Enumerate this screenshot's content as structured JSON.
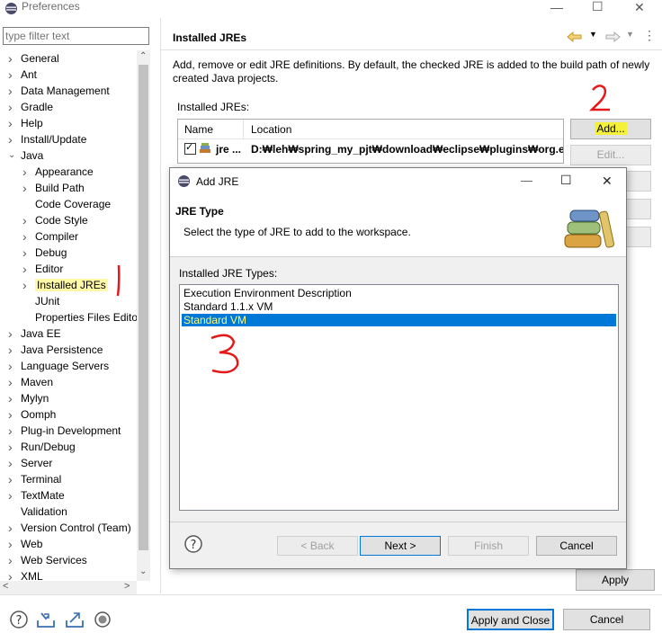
{
  "window": {
    "title": "Preferences"
  },
  "filter": {
    "placeholder": "type filter text"
  },
  "tree": [
    {
      "label": "General",
      "level": 0,
      "expandable": true
    },
    {
      "label": "Ant",
      "level": 0,
      "expandable": true
    },
    {
      "label": "Data Management",
      "level": 0,
      "expandable": true
    },
    {
      "label": "Gradle",
      "level": 0,
      "expandable": true
    },
    {
      "label": "Help",
      "level": 0,
      "expandable": true
    },
    {
      "label": "Install/Update",
      "level": 0,
      "expandable": true
    },
    {
      "label": "Java",
      "level": 0,
      "expandable": true,
      "expanded": true
    },
    {
      "label": "Appearance",
      "level": 1,
      "expandable": true
    },
    {
      "label": "Build Path",
      "level": 1,
      "expandable": true
    },
    {
      "label": "Code Coverage",
      "level": 1,
      "expandable": false
    },
    {
      "label": "Code Style",
      "level": 1,
      "expandable": true
    },
    {
      "label": "Compiler",
      "level": 1,
      "expandable": true
    },
    {
      "label": "Debug",
      "level": 1,
      "expandable": true
    },
    {
      "label": "Editor",
      "level": 1,
      "expandable": true
    },
    {
      "label": "Installed JREs",
      "level": 1,
      "expandable": true,
      "selected": true
    },
    {
      "label": "JUnit",
      "level": 1,
      "expandable": false
    },
    {
      "label": "Properties Files Edito",
      "level": 1,
      "expandable": false
    },
    {
      "label": "Java EE",
      "level": 0,
      "expandable": true
    },
    {
      "label": "Java Persistence",
      "level": 0,
      "expandable": true
    },
    {
      "label": "Language Servers",
      "level": 0,
      "expandable": true
    },
    {
      "label": "Maven",
      "level": 0,
      "expandable": true
    },
    {
      "label": "Mylyn",
      "level": 0,
      "expandable": true
    },
    {
      "label": "Oomph",
      "level": 0,
      "expandable": true
    },
    {
      "label": "Plug-in Development",
      "level": 0,
      "expandable": true
    },
    {
      "label": "Run/Debug",
      "level": 0,
      "expandable": true
    },
    {
      "label": "Server",
      "level": 0,
      "expandable": true
    },
    {
      "label": "Terminal",
      "level": 0,
      "expandable": true
    },
    {
      "label": "TextMate",
      "level": 0,
      "expandable": true
    },
    {
      "label": "Validation",
      "level": 0,
      "expandable": false
    },
    {
      "label": "Version Control (Team)",
      "level": 0,
      "expandable": true
    },
    {
      "label": "Web",
      "level": 0,
      "expandable": true
    },
    {
      "label": "Web Services",
      "level": 0,
      "expandable": true
    },
    {
      "label": "XML",
      "level": 0,
      "expandable": true
    }
  ],
  "page": {
    "title": "Installed JREs",
    "description": "Add, remove or edit JRE definitions. By default, the checked JRE is added to the build path of newly created Java projects.",
    "installed_label": "Installed JREs:",
    "table": {
      "columns": [
        "Name",
        "Location"
      ],
      "rows": [
        {
          "name": "jre ...",
          "location": "D:₩leh₩spring_my_pjt₩download₩eclipse₩plugins₩org.eclip",
          "checked": true
        }
      ]
    },
    "buttons": {
      "add": "Add...",
      "edit": "Edit..."
    },
    "apply": "Apply"
  },
  "footer": {
    "apply_close": "Apply and Close",
    "cancel": "Cancel"
  },
  "dialog": {
    "title": "Add JRE",
    "header_title": "JRE Type",
    "header_desc": "Select the type of JRE to add to the workspace.",
    "list_label": "Installed JRE Types:",
    "types": [
      "Execution Environment Description",
      "Standard 1.1.x VM",
      "Standard VM"
    ],
    "selected_index": 2,
    "buttons": {
      "back": "< Back",
      "next": "Next >",
      "finish": "Finish",
      "cancel": "Cancel"
    }
  },
  "annotations": [
    "1",
    "2",
    "3"
  ],
  "colors": {
    "selection": "#0078d7",
    "highlight": "#fff8a6",
    "annotation": "#e41a1a"
  }
}
